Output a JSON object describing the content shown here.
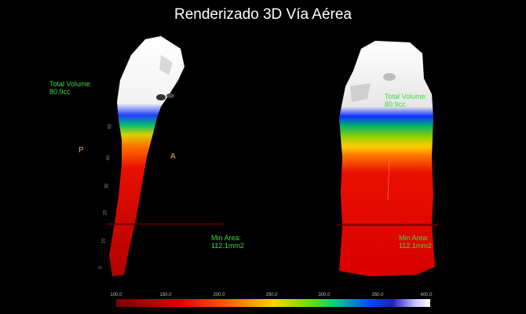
{
  "title": "Renderizado 3D Vía Aérea",
  "left_view": {
    "total_volume_label": "Total Volume:",
    "total_volume_value": "80.9cc",
    "min_area_label": "Min Area:",
    "min_area_value": "112.1mm2",
    "orientation_posterior": "P",
    "orientation_anterior": "A",
    "scale_ticks": [
      "50",
      "40",
      "30",
      "20",
      "10",
      "0"
    ]
  },
  "right_view": {
    "total_volume_label": "Total Volume:",
    "total_volume_value": "80.9cc",
    "min_area_label": "Min Area:",
    "min_area_value": "112.1mm2"
  },
  "colorbar": {
    "labels": [
      "100.0",
      "150.0",
      "200.0",
      "250.0",
      "300.0",
      "350.0",
      "400.0"
    ]
  },
  "colors": {
    "background": "#000000",
    "annotation_green": "#3fd93f",
    "orientation_gold": "#d9b15a"
  }
}
